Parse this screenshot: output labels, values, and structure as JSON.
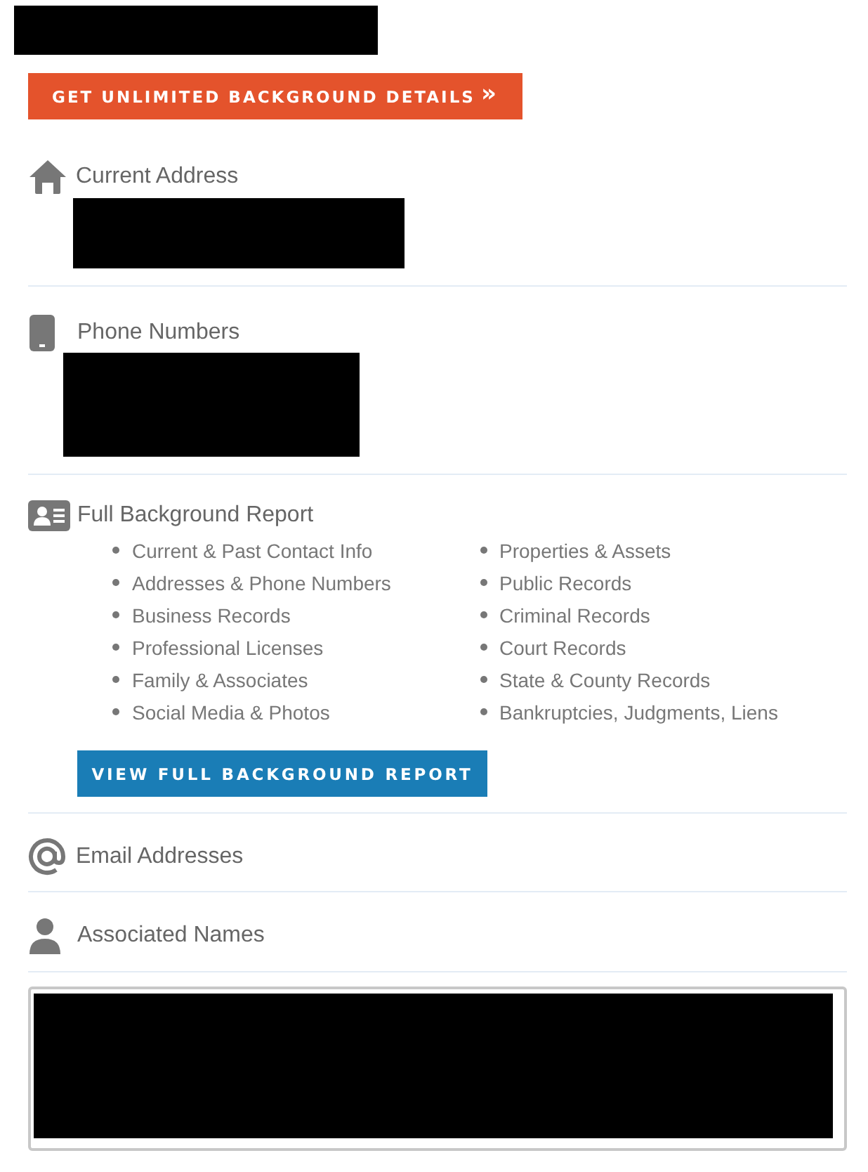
{
  "header": {
    "redacted": true
  },
  "upgrade_button": {
    "label": "GET UNLIMITED BACKGROUND DETAILS",
    "icon": "»"
  },
  "sections": [
    {
      "kind": "address",
      "title": "Current Address",
      "redacted": true
    },
    {
      "kind": "phone",
      "title": "Phone Numbers",
      "redacted": true
    },
    {
      "kind": "report",
      "title": "Full Background Report",
      "items_left": [
        "Current & Past Contact Info",
        "Addresses & Phone Numbers",
        "Business Records",
        "Professional Licenses",
        "Family & Associates",
        "Social Media & Photos"
      ],
      "items_right": [
        "Properties & Assets",
        "Public Records",
        "Criminal Records",
        "Court Records",
        "State & County Records",
        "Bankruptcies, Judgments, Liens"
      ],
      "button": "VIEW FULL BACKGROUND REPORT"
    },
    {
      "kind": "email",
      "title": "Email Addresses"
    },
    {
      "kind": "person",
      "title": "Associated Names"
    }
  ],
  "names_box": {
    "redacted": true
  }
}
